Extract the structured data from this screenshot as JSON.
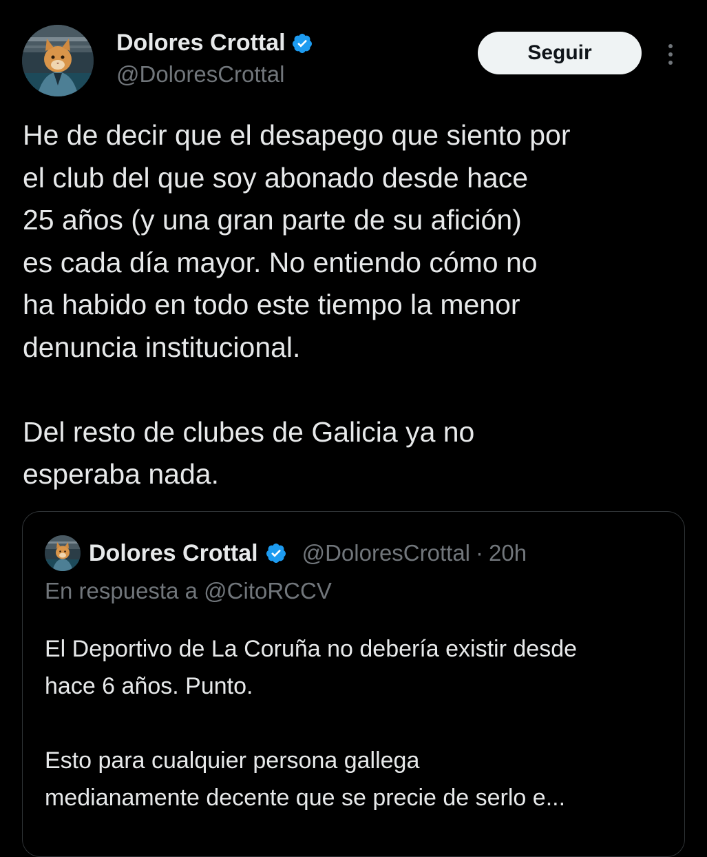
{
  "author": {
    "name": "Dolores Crottal",
    "handle": "@DoloresCrottal",
    "verified": true
  },
  "actions": {
    "follow_label": "Seguir"
  },
  "tweet": {
    "paragraphs": [
      "He de decir que el desapego que siento por\nel club del que soy abonado desde hace\n25 años (y una gran parte de su afición)\nes cada día mayor. No entiendo cómo no\nha habido en todo este tiempo la menor\ndenuncia institucional.",
      "Del resto de clubes de Galicia ya no\nesperaba nada."
    ]
  },
  "quote": {
    "name": "Dolores Crottal",
    "handle": "@DoloresCrottal",
    "separator": "·",
    "time": "20h",
    "reply_prefix": "En respuesta a",
    "reply_to": "@CitoRCCV",
    "paragraphs": [
      "El Deportivo de La Coruña no debería existir desde\nhace 6 años. Punto.",
      "Esto para cualquier persona gallega\nmedianamente decente que se precie de serlo e..."
    ]
  },
  "colors": {
    "background": "#000000",
    "text_primary": "#e7e9ea",
    "text_secondary": "#71767b",
    "verified_blue": "#1d9bf0",
    "border": "#2f3336",
    "button_bg": "#eff3f4"
  },
  "icons": {
    "verified": "verified-badge-icon",
    "more": "more-vertical-icon"
  }
}
